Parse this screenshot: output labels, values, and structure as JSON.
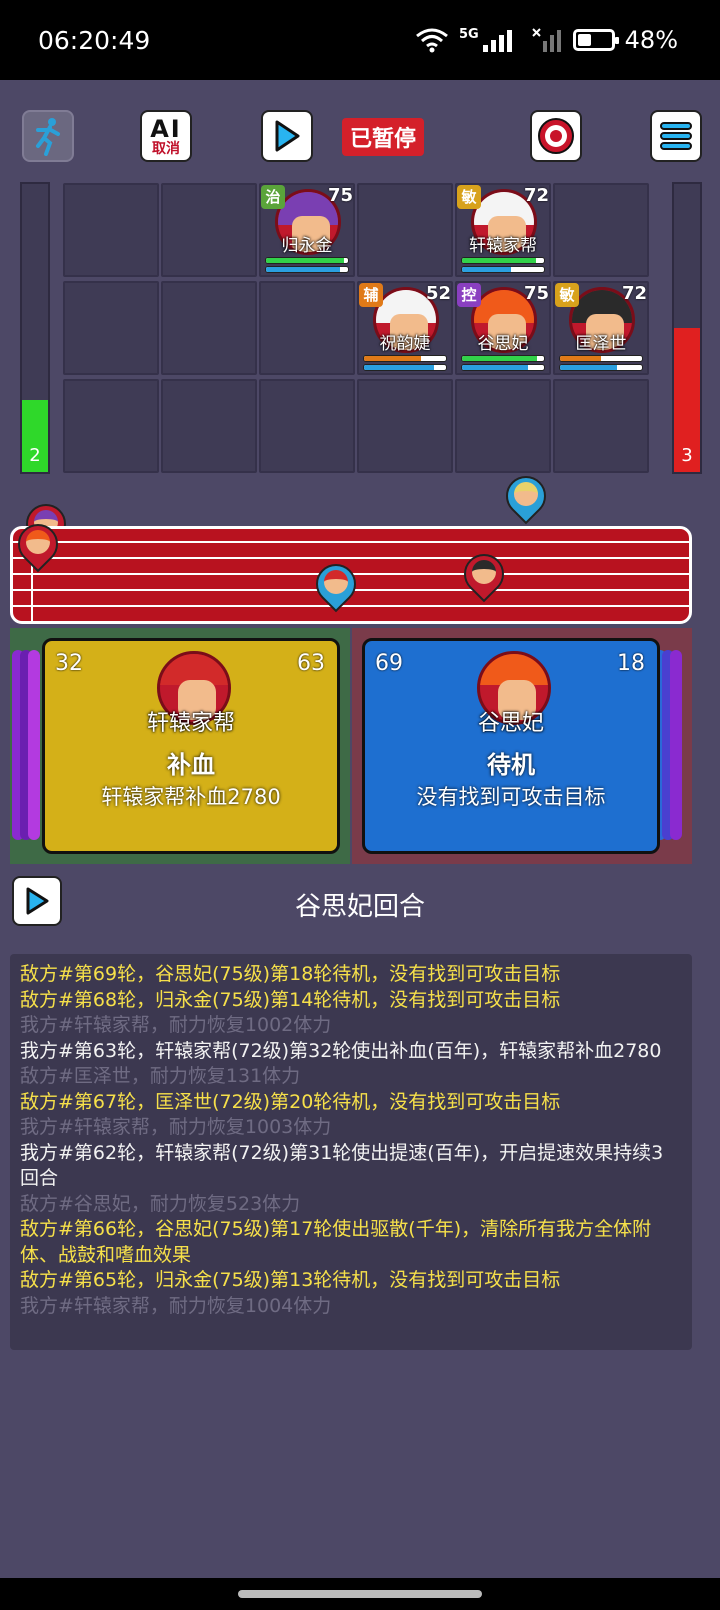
{
  "status": {
    "time": "06:20:49",
    "network": "5G",
    "battery": "48%",
    "battery_level": 0.48
  },
  "toolbar": {
    "ai_line1": "AI",
    "ai_line2": "取消",
    "paused_label": "已暂停"
  },
  "sides": {
    "left_count": "2",
    "left_fill": 0.25,
    "left_color": "#2fd82a",
    "right_count": "3",
    "right_fill": 0.5,
    "right_color": "#e02020"
  },
  "units": [
    {
      "name": "归永金",
      "role": "治",
      "role_color": "#5aa43a",
      "level": "75",
      "hp": 0.95,
      "mp": 0.9,
      "hair": "#7a3fb2",
      "col": 2,
      "row": 0,
      "hp_color": "#32d24a",
      "mp_color": "#2a9fe0"
    },
    {
      "name": "轩辕家帮",
      "role": "敏",
      "role_color": "#d8a21c",
      "level": "72",
      "hp": 0.9,
      "mp": 0.6,
      "hair": "#f4f4f4",
      "col": 4,
      "row": 0,
      "hp_color": "#32d24a",
      "mp_color": "#2a9fe0"
    },
    {
      "name": "祝韵婕",
      "role": "辅",
      "role_color": "#e07a18",
      "level": "52",
      "hp": 0.7,
      "mp": 0.85,
      "hair": "#f4f4f4",
      "col": 3,
      "row": 1,
      "hp_color": "#e07a18",
      "mp_color": "#2a9fe0"
    },
    {
      "name": "谷思妃",
      "role": "控",
      "role_color": "#8a3fc0",
      "level": "75",
      "hp": 0.92,
      "mp": 0.8,
      "hair": "#f05a1a",
      "col": 4,
      "row": 1,
      "hp_color": "#32d24a",
      "mp_color": "#2a9fe0"
    },
    {
      "name": "匡泽世",
      "role": "敏",
      "role_color": "#d8a21c",
      "level": "72",
      "hp": 0.5,
      "mp": 0.7,
      "hair": "#2a2a2a",
      "col": 5,
      "row": 1,
      "hp_color": "#e07a18",
      "mp_color": "#2a9fe0"
    }
  ],
  "cards": {
    "left": {
      "num_left": "32",
      "num_right": "63",
      "name": "轩辕家帮",
      "action": "补血",
      "desc": "轩辕家帮补血2780",
      "hair": "#d22a2a"
    },
    "right": {
      "num_left": "69",
      "num_right": "18",
      "name": "谷思妃",
      "action": "待机",
      "desc": "没有找到可攻击目标",
      "hair": "#f05a1a"
    }
  },
  "turn_title": "谷思妃回合",
  "log": [
    {
      "text": "敌方#第69轮，谷思妃(75级)第18轮待机，没有找到可攻击目标",
      "color": "yellow"
    },
    {
      "text": "敌方#第68轮，归永金(75级)第14轮待机，没有找到可攻击目标",
      "color": "yellow"
    },
    {
      "text": "我方#轩辕家帮，耐力恢复1002体力",
      "color": "gray"
    },
    {
      "text": "我方#第63轮，轩辕家帮(72级)第32轮使出补血(百年)，轩辕家帮补血2780",
      "color": "white"
    },
    {
      "text": "敌方#匡泽世，耐力恢复131体力",
      "color": "gray"
    },
    {
      "text": "敌方#第67轮，匡泽世(72级)第20轮待机，没有找到可攻击目标",
      "color": "yellow"
    },
    {
      "text": "我方#轩辕家帮，耐力恢复1003体力",
      "color": "gray"
    },
    {
      "text": "我方#第62轮，轩辕家帮(72级)第31轮使出提速(百年)，开启提速效果持续3回合",
      "color": "white"
    },
    {
      "text": "敌方#谷思妃，耐力恢复523体力",
      "color": "gray"
    },
    {
      "text": "敌方#第66轮，谷思妃(75级)第17轮使出驱散(千年)，清除所有我方全体附体、战鼓和嗜血效果",
      "color": "yellow"
    },
    {
      "text": "敌方#第65轮，归永金(75级)第13轮待机，没有找到可攻击目标",
      "color": "yellow"
    },
    {
      "text": "我方#轩辕家帮，耐力恢复1004体力",
      "color": "gray"
    }
  ]
}
